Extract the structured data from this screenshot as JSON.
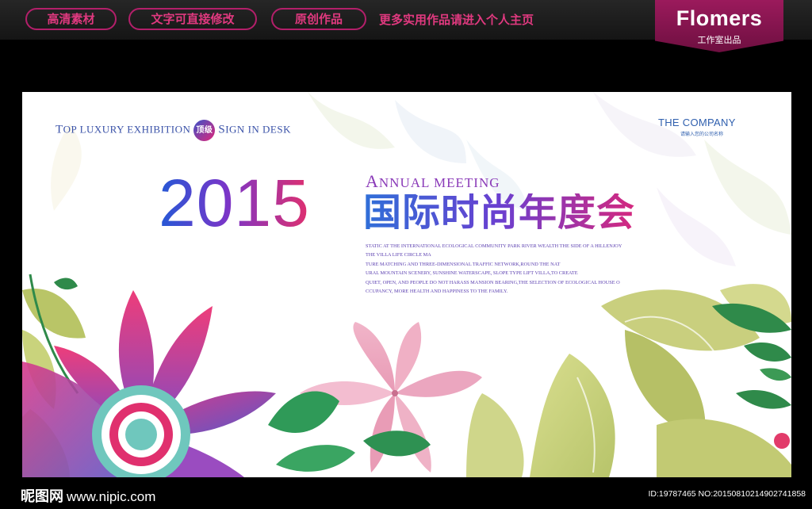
{
  "header": {
    "tags": [
      "高清素材",
      "文字可直接修改",
      "原创作品"
    ],
    "promo": "更多实用作品请进入个人主页",
    "brand_name": "Flomers",
    "brand_sub": "工作室出品"
  },
  "poster": {
    "top_line": {
      "top_cap": "T",
      "top_rest": "OP",
      "luxury": "LUXURY",
      "exhibition": "EXHIBITION",
      "badge": "顶级",
      "sign_cap": "S",
      "sign_rest": "IGN",
      "in": "IN",
      "desk": "DESK"
    },
    "company": "THE COMPANY",
    "company_sub": "请输入您的公司名称",
    "year": "2015",
    "annual_cap": "A",
    "annual_rest": "NNUAL",
    "meeting": "MEETING",
    "cn_title": "国际时尚年度会",
    "body_lines": [
      "STATIC AT THE INTERNATIONAL ECOLOGICAL COMMUNITY PARK RIVER WEALTH THE SIDE OF A HILLENJOY",
      "THE VILLA LIFE CIRCLE MA",
      "TURE MATCHING AND THREE-DIMENSIONAL TRAFFIC NETWORK,ROUND THE NAT",
      "URAL MOUNTAIN SCENERY, SUNSHINE WATERSCAPE, SLOPE TYPE LIFT VILLA,TO CREATE",
      "QUIET, OPEN, AND PEOPLE DO NOT HARASS MANSION BEARING,THE SELECTION OF ECOLOGICAL HOUSE O",
      "CCUPANCY, MORE HEALTH AND HAPPINESS TO THE FAMILY."
    ]
  },
  "footer": {
    "logo": "昵图网",
    "site": "www.nipic.com",
    "ident": "ID:19787465 NO:20150810214902741858"
  },
  "colors": {
    "accent_magenta": "#e0397f",
    "brand_bg": "#9b1a5c",
    "title_blue": "#2459d6",
    "title_pink": "#e0306e"
  }
}
